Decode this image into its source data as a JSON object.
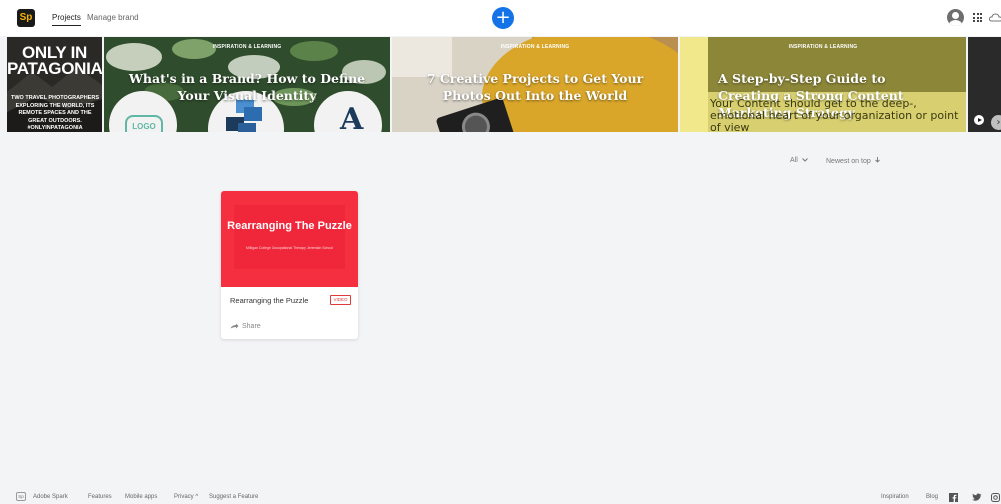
{
  "header": {
    "logo_text": "Sp",
    "nav": [
      "Projects",
      "Manage brand"
    ],
    "add_label": "+"
  },
  "banner": {
    "tile1": {
      "title": "ONLY IN PATAGONIA",
      "subtitle": "TWO TRAVEL PHOTOGRAPHERS EXPLORING THE WORLD, ITS REMOTE SPACES AND THE GREAT OUTDOORS. #ONLYINPATAGONIA"
    },
    "tile2": {
      "category": "INSPIRATION & LEARNING",
      "title": "What's in a Brand? How to Define Your Visual Identity",
      "logo_badge": "LOGO",
      "letter": "A"
    },
    "tile3": {
      "category": "INSPIRATION & LEARNING",
      "title": "7 Creative Projects to Get Your Photos Out Into the World"
    },
    "tile4": {
      "category": "INSPIRATION & LEARNING",
      "title": "A Step-by-Step Guide to Creating a Strong Content Marketing Strategy",
      "body_text": "Your Content should get to the deep-, emotional heart of your organization or point of view"
    },
    "next_arrow": "›"
  },
  "filters": {
    "scope": "All",
    "scope_icon": "chevron-down-icon",
    "sort": "Newest on top",
    "sort_icon": "arrow-down-icon"
  },
  "projects": [
    {
      "thumb_title": "Rearranging The Puzzle",
      "thumb_subtitle": "Milligan College Occupational Therapy Jeremiah School",
      "title": "Rearranging the Puzzle",
      "badge": "VIDEO",
      "share_label": "Share"
    }
  ],
  "footer": {
    "logo": "Sp",
    "brand": "Adobe Spark",
    "links": [
      "Features",
      "Mobile apps",
      "Privacy",
      "Suggest a Feature"
    ],
    "privacy_caret": "^",
    "right_links": [
      "Inspiration",
      "Blog"
    ],
    "social": [
      "facebook-icon",
      "twitter-icon",
      "instagram-icon"
    ]
  },
  "colors": {
    "accent": "#1473e6",
    "card_red": "#f52f3f",
    "badge_red": "#e03a3a",
    "background": "#f3f4f6"
  }
}
